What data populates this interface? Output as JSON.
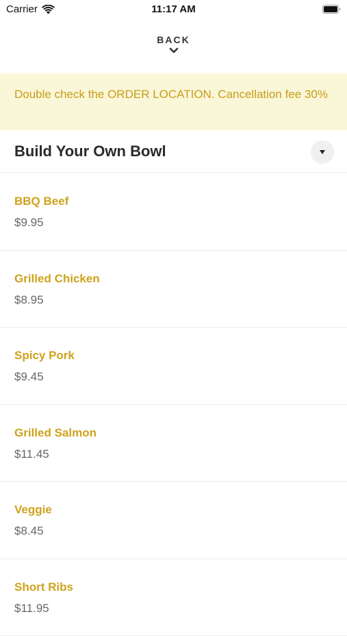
{
  "status_bar": {
    "carrier": "Carrier",
    "time": "11:17 AM"
  },
  "nav": {
    "back_label": "BACK"
  },
  "notice": {
    "text": "Double check the ORDER LOCATION. Cancellation fee 30%"
  },
  "category": {
    "title": "Build Your Own Bowl"
  },
  "items": [
    {
      "name": "BBQ Beef",
      "price": "$9.95"
    },
    {
      "name": "Grilled Chicken",
      "price": "$8.95"
    },
    {
      "name": "Spicy Pork",
      "price": "$9.45"
    },
    {
      "name": "Grilled Salmon",
      "price": "$11.45"
    },
    {
      "name": "Veggie",
      "price": "$8.45"
    },
    {
      "name": "Short Ribs",
      "price": "$11.95"
    }
  ],
  "colors": {
    "accent": "#cfa21c",
    "notice_bg": "#faf6d8",
    "notice_text": "#c79e18",
    "price_text": "#666666"
  },
  "icons": {
    "wifi": "wifi-icon",
    "battery": "battery-icon",
    "back_chevron": "chevron-down-icon",
    "dropdown": "caret-down-icon"
  }
}
